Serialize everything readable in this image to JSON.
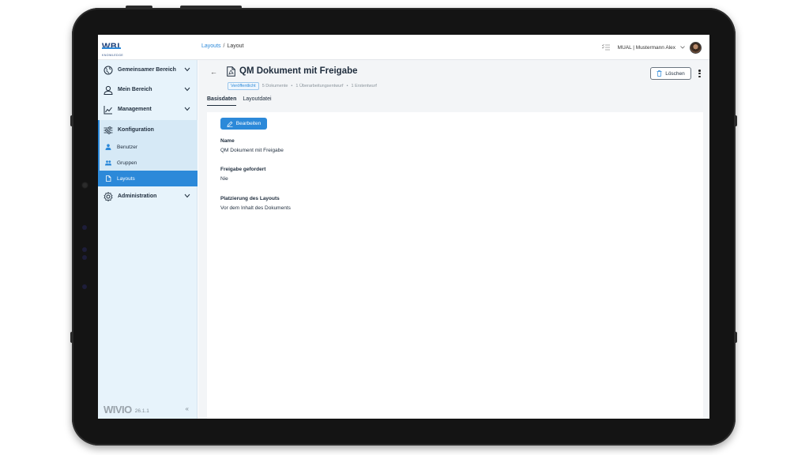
{
  "header": {
    "logo_text": "WBI",
    "logo_sub": "KNOWLEDGE",
    "breadcrumb": [
      "Layouts",
      "/",
      "Layout"
    ],
    "user": "MUAL | Mustermann Alex"
  },
  "sidebar": {
    "items": [
      {
        "label": "Gemeinsamer Bereich",
        "icon": "globe-icon"
      },
      {
        "label": "Mein Bereich",
        "icon": "user-icon"
      },
      {
        "label": "Management",
        "icon": "chart-icon"
      },
      {
        "label": "Konfiguration",
        "icon": "sliders-icon"
      },
      {
        "label": "Administration",
        "icon": "gear-icon"
      }
    ],
    "sub_items": [
      {
        "label": "Benutzer",
        "icon": "person-icon"
      },
      {
        "label": "Gruppen",
        "icon": "group-icon"
      },
      {
        "label": "Layouts",
        "icon": "file-icon"
      }
    ],
    "product": "WIVIO",
    "version": "26.1.1",
    "collapse": "«"
  },
  "main": {
    "back": "←",
    "title": "QM Dokument mit Freigabe",
    "badge": "Veröffentlicht",
    "meta": [
      "5 Dokumente",
      "•",
      "1 Überarbeitungsentwurf",
      "•",
      "1 Erstentwurf"
    ],
    "delete_label": "Löschen",
    "tabs": [
      "Basisdaten",
      "Layoutdatei"
    ],
    "edit_label": "Bearbeiten",
    "fields": [
      {
        "label": "Name",
        "value": "QM Dokument mit Freigabe"
      },
      {
        "label": "Freigabe gefordert",
        "value": "Nie"
      },
      {
        "label": "Platzierung des Layouts",
        "value": "Vor dem Inhalt des Dokuments"
      }
    ]
  },
  "colors": {
    "accent": "#2c89d9",
    "sidebar_bg": "#e7f3fb",
    "frame": "#141414"
  }
}
